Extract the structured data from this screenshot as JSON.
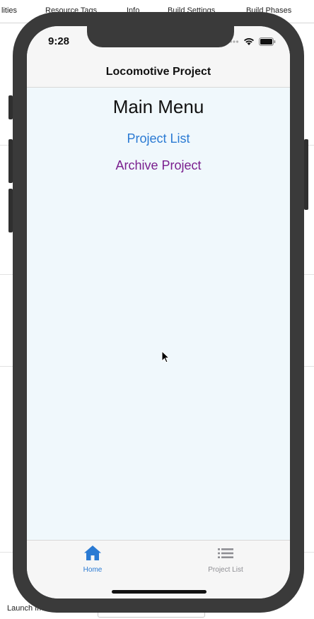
{
  "xcode": {
    "tabs": [
      "lities",
      "Resource Tags",
      "Info",
      "Build Settings",
      "Build Phases"
    ],
    "launch_label": "Launch Ima"
  },
  "status_bar": {
    "time": "9:28"
  },
  "nav": {
    "title": "Locomotive Project"
  },
  "main": {
    "heading": "Main Menu",
    "links": [
      {
        "label": "Project List",
        "color": "#2a7ad3"
      },
      {
        "label": "Archive Project",
        "color": "#7a1f8e"
      }
    ]
  },
  "tab_bar": {
    "items": [
      {
        "label": "Home",
        "icon": "home-icon",
        "selected": true
      },
      {
        "label": "Project List",
        "icon": "list-icon",
        "selected": false
      }
    ]
  },
  "colors": {
    "accent": "#2a7ad3",
    "visited_link": "#7a1f8e",
    "background": "#f0f8fc"
  }
}
